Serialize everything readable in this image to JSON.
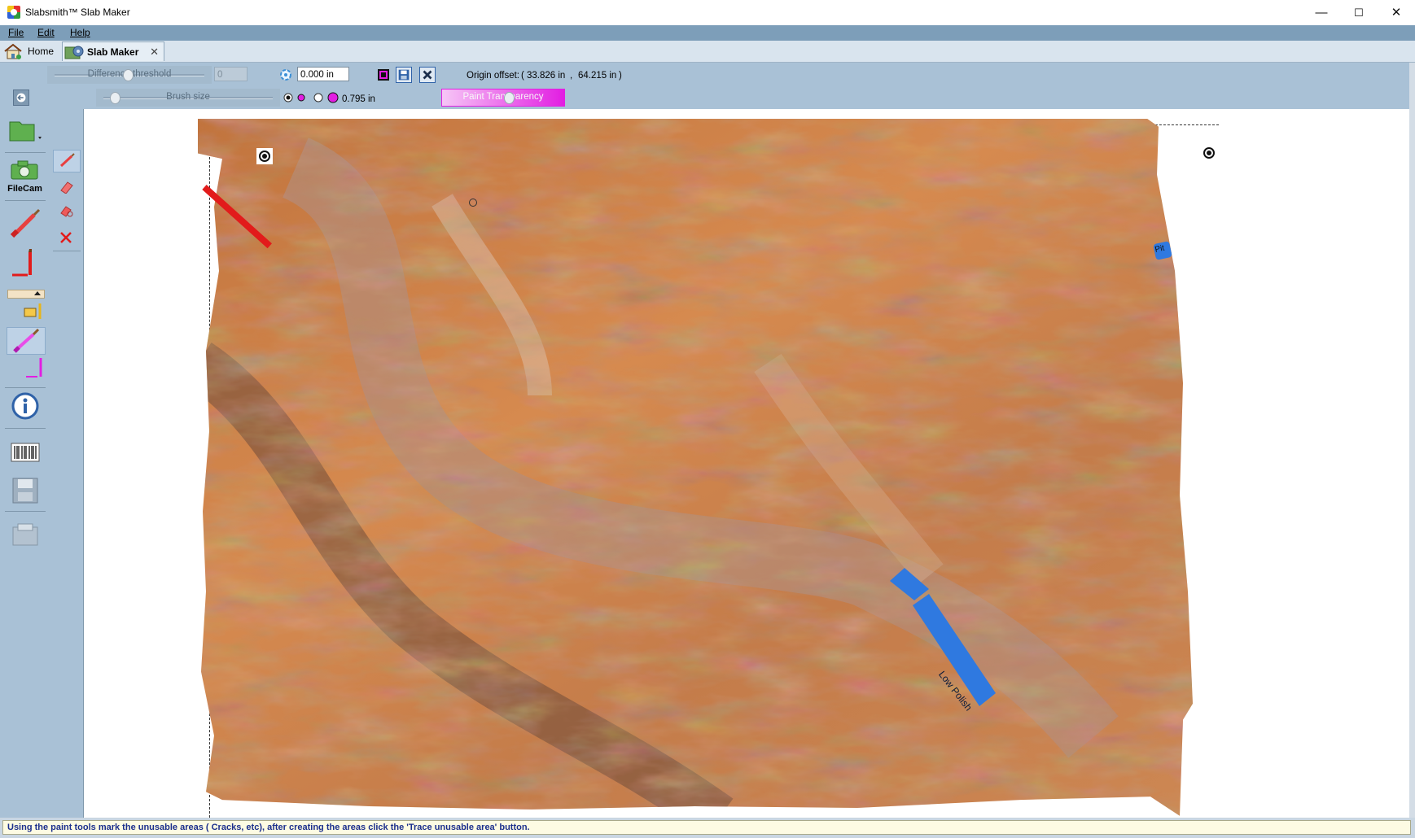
{
  "window": {
    "title": "Slabsmith™ Slab Maker",
    "controls": {
      "minimize": "—",
      "maximize": "☐",
      "close": "✕"
    }
  },
  "menu": [
    "File",
    "Edit",
    "Help"
  ],
  "tabs": [
    {
      "label": "Home",
      "icon": "home-icon"
    },
    {
      "label": "Slab Maker",
      "icon": "gear-icon",
      "close": "✕",
      "active": true
    }
  ],
  "toolbar1": {
    "difference_threshold_label": "Difference threshold",
    "difference_threshold_value": "0",
    "offset_value": "0.000 in",
    "origin_offset_label": "Origin offset:",
    "origin_offset_x": "33.826 in",
    "origin_offset_y": "64.215 in"
  },
  "toolbar2": {
    "brush_size_label": "Brush size",
    "brush_size_value": "0.795 in",
    "paint_transparency_label": "Paint Transparency"
  },
  "left_tools": {
    "filecam_label": "FileCam"
  },
  "slab": {
    "annotation_pit": "Pit",
    "annotation_low_polish": "Low Polish"
  },
  "status": {
    "message": "Using the paint tools mark the unusable areas ( Cracks, etc), after creating the areas click the 'Trace unusable area' button."
  },
  "colors": {
    "accent_magenta": "#e21ee2",
    "mark_red": "#e21b1b",
    "mark_blue": "#2f79e0",
    "status_text": "#1b2f8d"
  }
}
